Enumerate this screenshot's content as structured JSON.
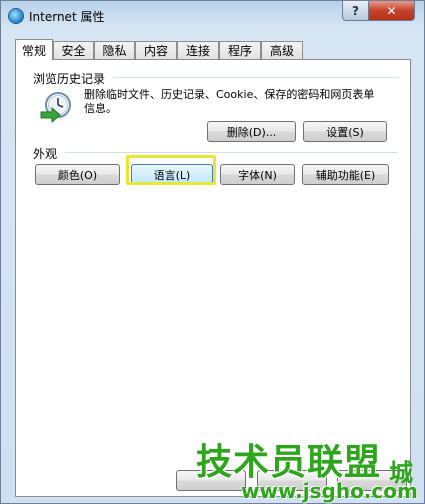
{
  "window": {
    "title": "Internet 属性",
    "help_label": "?",
    "close_label": "✕"
  },
  "tabs": [
    {
      "label": "常规",
      "active": true
    },
    {
      "label": "安全"
    },
    {
      "label": "隐私"
    },
    {
      "label": "内容"
    },
    {
      "label": "连接"
    },
    {
      "label": "程序"
    },
    {
      "label": "高级"
    }
  ],
  "history": {
    "group_label": "浏览历史记录",
    "description": "删除临时文件、历史记录、Cookie、保存的密码和网页表单信息。",
    "delete_label": "删除(D)...",
    "settings_label": "设置(S)"
  },
  "appearance": {
    "group_label": "外观",
    "colors_label": "颜色(O)",
    "languages_label": "语言(L)",
    "fonts_label": "字体(N)",
    "accessibility_label": "辅助功能(E)"
  },
  "watermark": {
    "main": "技术员联盟",
    "url": "www.jsgho.com",
    "city": "城"
  }
}
